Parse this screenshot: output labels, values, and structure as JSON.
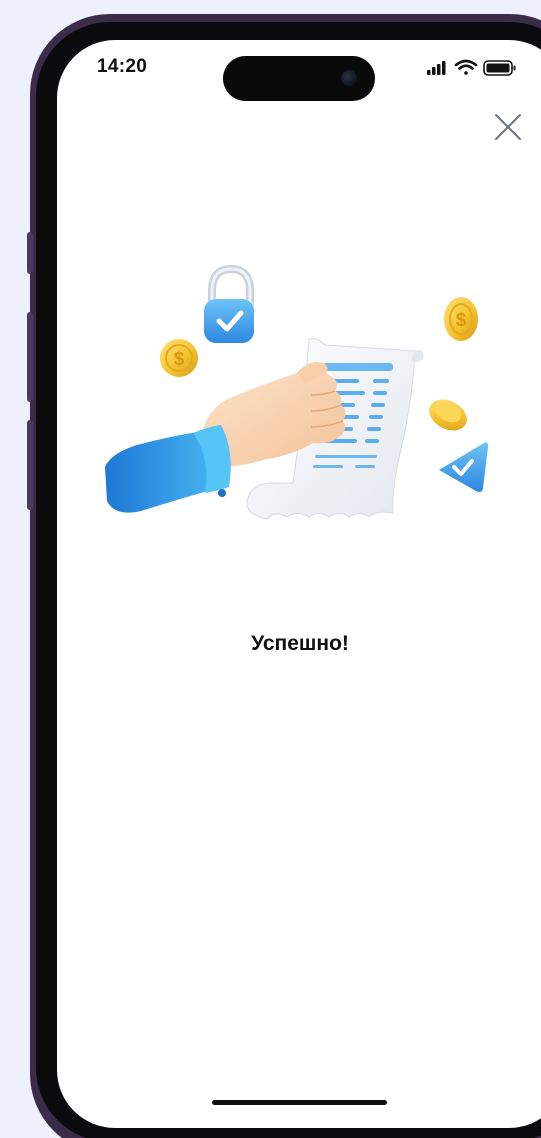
{
  "status_bar": {
    "time": "14:20",
    "icons": [
      "cellular-signal-icon",
      "wifi-icon",
      "battery-icon"
    ]
  },
  "header": {
    "close_icon": "close-icon"
  },
  "main": {
    "illustration": "hand-holding-receipt-icon",
    "message": "Успешно!"
  },
  "colors": {
    "background": "#eef0fd",
    "frame": "#3b2d4a",
    "accent_blue": "#3aa3ea",
    "coin_gold": "#f5c331",
    "text": "#111111"
  }
}
